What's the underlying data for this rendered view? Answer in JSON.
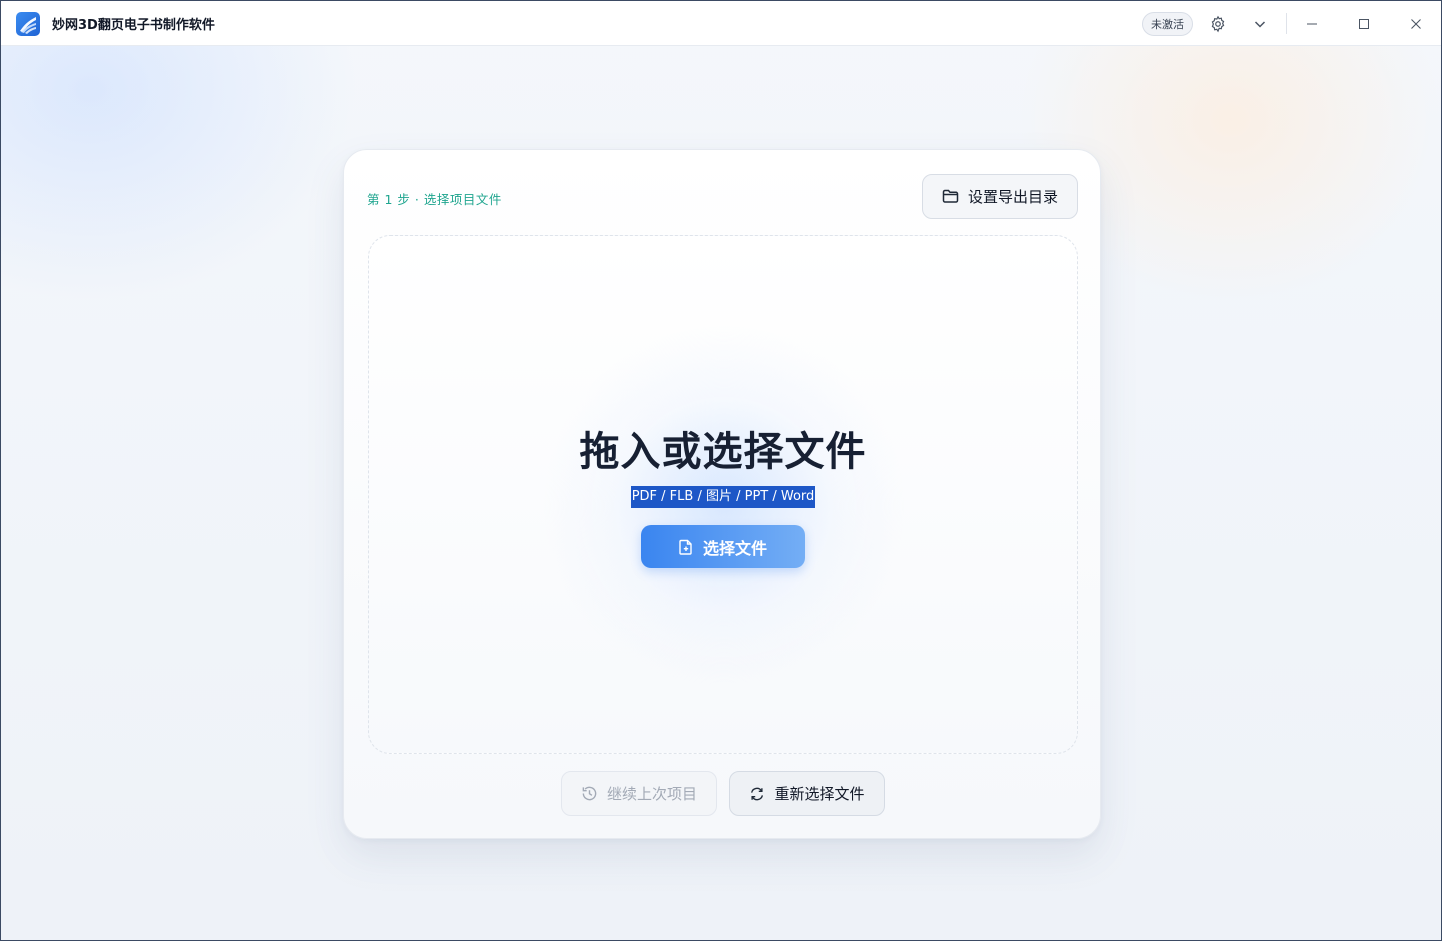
{
  "window": {
    "title": "妙网3D翻页电子书制作软件",
    "activation_badge": "未激活",
    "controls": [
      "settings-icon",
      "chevron-down-icon",
      "minimize-icon",
      "maximize-icon",
      "close-icon"
    ]
  },
  "card": {
    "step_label": "第 1 步 · 选择项目文件",
    "export_dir_button": "设置导出目录",
    "dropzone": {
      "title": "拖入或选择文件",
      "formats": "PDF / FLB / 图片 / PPT / Word",
      "select_button": "选择文件"
    },
    "resume_button": "继续上次项目",
    "reselect_button": "重新选择文件"
  },
  "colors": {
    "accent": "#3a85f0",
    "step_label": "#1fa58f",
    "selection_highlight": "#1d57c7"
  }
}
